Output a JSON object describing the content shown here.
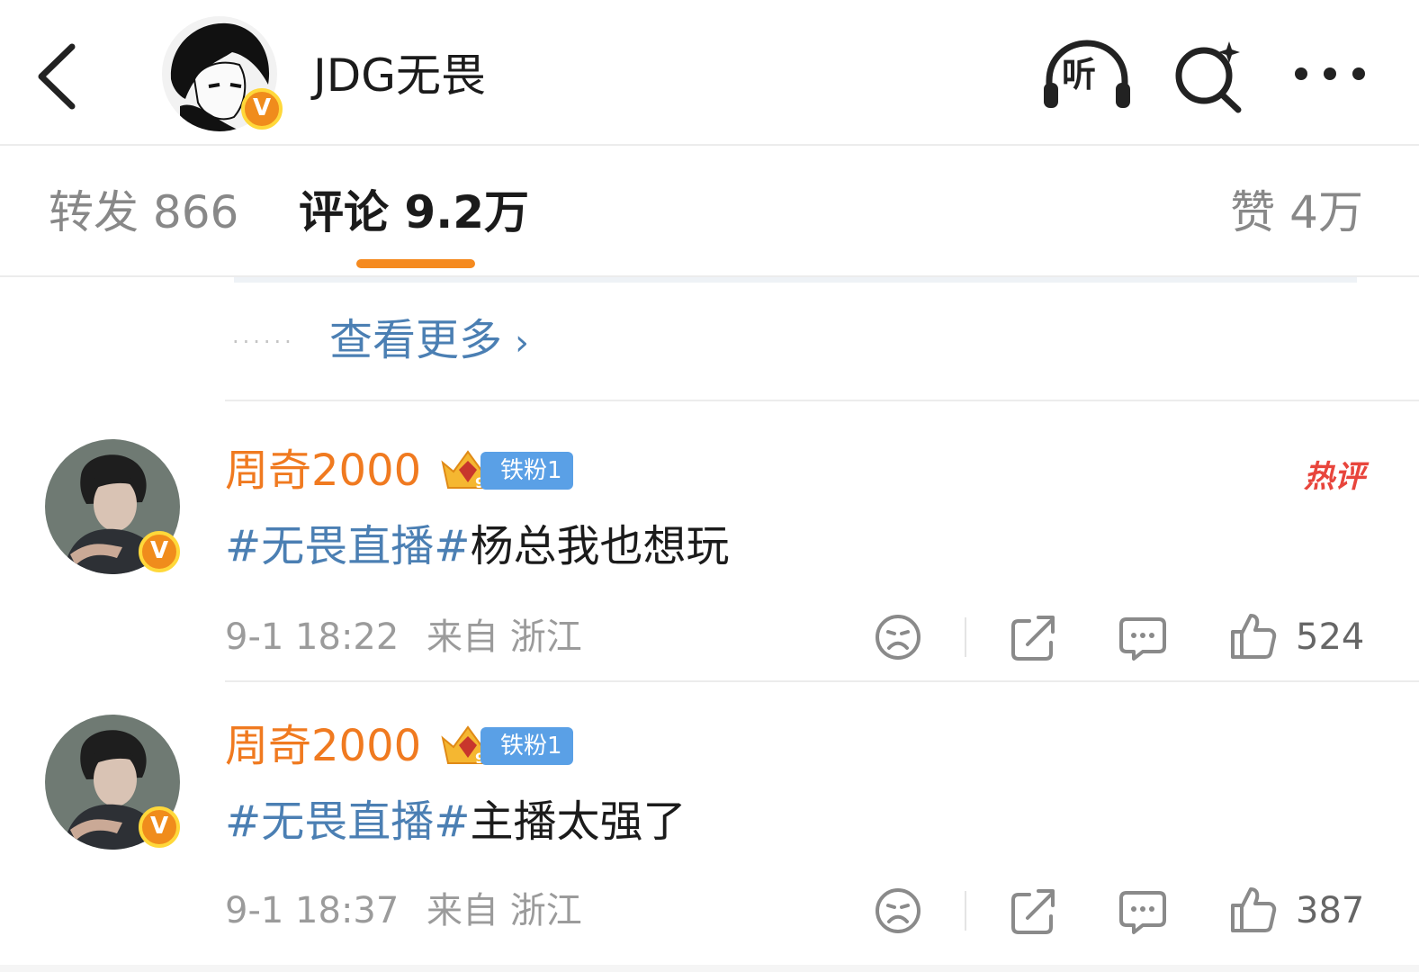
{
  "header": {
    "title": "JDG无畏",
    "listen_label": "听",
    "verified_mark": "V"
  },
  "tabs": {
    "repost": "转发 866",
    "comments": "评论 9.2万",
    "likes": "赞 4万",
    "active": "comments"
  },
  "view_more": {
    "dots": "······",
    "label": "查看更多",
    "chevron": "›"
  },
  "comments": [
    {
      "author": "周奇2000",
      "fan_badge": "铁粉1",
      "crown_level": "9",
      "hot_label": "热评",
      "topic": "#无畏直播#",
      "text": "杨总我也想玩",
      "time": "9-1 18:22",
      "location": "来自 浙江",
      "likes": "524"
    },
    {
      "author": "周奇2000",
      "fan_badge": "铁粉1",
      "crown_level": "9",
      "hot_label": "",
      "topic": "#无畏直播#",
      "text": "主播太强了",
      "time": "9-1 18:37",
      "location": "来自 浙江",
      "likes": "387"
    }
  ],
  "colors": {
    "accent_orange": "#f58a1f",
    "name_orange": "#f07a20",
    "topic_blue": "#4b7fb3",
    "hot_red": "#e8453c",
    "fan_blue": "#5aa0e6"
  },
  "icons": [
    "back-arrow-icon",
    "headphones-icon",
    "search-sparkle-icon",
    "more-dots-icon",
    "sad-face-icon",
    "share-icon",
    "comment-bubble-icon",
    "thumbs-up-icon"
  ]
}
